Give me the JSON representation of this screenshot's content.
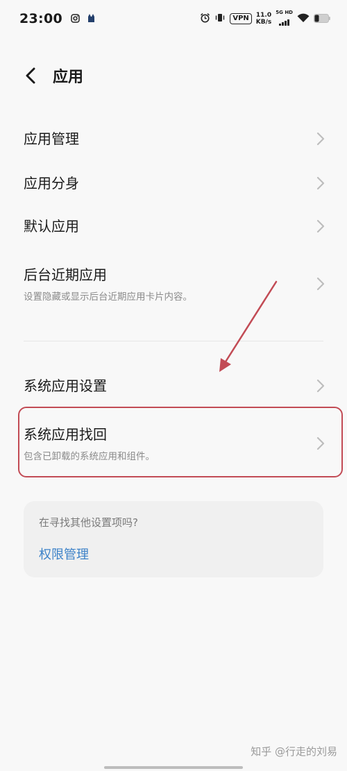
{
  "status_bar": {
    "time": "23:00",
    "vpn": "VPN",
    "net_speed_value": "11.0",
    "net_speed_unit": "KB/s",
    "signal_label": "5G HD",
    "icons_left": [
      "instagram-icon",
      "app-notification-icon"
    ],
    "icons_right": [
      "alarm-icon",
      "vibrate-icon",
      "vpn-badge",
      "signal-icon",
      "wifi-icon",
      "battery-icon"
    ]
  },
  "header": {
    "title": "应用"
  },
  "rows": [
    {
      "title": "应用管理",
      "subtitle": ""
    },
    {
      "title": "应用分身",
      "subtitle": ""
    },
    {
      "title": "默认应用",
      "subtitle": ""
    },
    {
      "title": "后台近期应用",
      "subtitle": "设置隐藏或显示后台近期应用卡片内容。"
    },
    {
      "title": "系统应用设置",
      "subtitle": ""
    },
    {
      "title": "系统应用找回",
      "subtitle": "包含已卸载的系统应用和组件。"
    }
  ],
  "tip_card": {
    "question": "在寻找其他设置项吗?",
    "link": "权限管理"
  },
  "watermark": "知乎 @行走的刘易",
  "colors": {
    "highlight": "#c24b55",
    "link": "#3d82c8",
    "arrow": "#c24b55"
  }
}
